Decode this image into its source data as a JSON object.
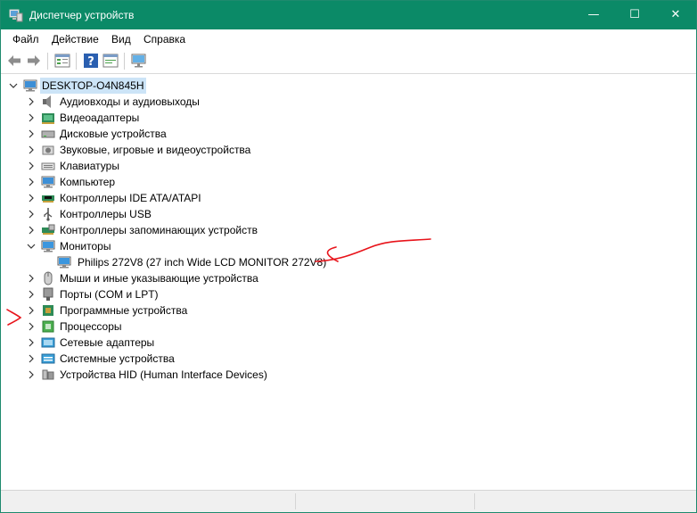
{
  "window": {
    "title": "Диспетчер устройств",
    "controls": {
      "minimize": "—",
      "maximize": "☐",
      "close": "✕"
    },
    "accent_color": "#0b8a67"
  },
  "menu": [
    "Файл",
    "Действие",
    "Вид",
    "Справка"
  ],
  "toolbar": {
    "buttons": [
      "back-arrow-icon",
      "forward-arrow-icon",
      "properties-icon",
      "help-icon",
      "scan-icon",
      "monitor-icon"
    ]
  },
  "tree": {
    "root": {
      "label": "DESKTOP-O4N845H",
      "icon": "computer-icon",
      "expanded": true
    },
    "categories": [
      {
        "label": "Аудиовходы и аудиовыходы",
        "icon": "speaker-icon",
        "expanded": false
      },
      {
        "label": "Видеоадаптеры",
        "icon": "display-adapter-icon",
        "expanded": false
      },
      {
        "label": "Дисковые устройства",
        "icon": "disk-drive-icon",
        "expanded": false
      },
      {
        "label": "Звуковые, игровые и видеоустройства",
        "icon": "sound-icon",
        "expanded": false
      },
      {
        "label": "Клавиатуры",
        "icon": "keyboard-icon",
        "expanded": false
      },
      {
        "label": "Компьютер",
        "icon": "computer-icon",
        "expanded": false
      },
      {
        "label": "Контроллеры IDE ATA/ATAPI",
        "icon": "ide-controller-icon",
        "expanded": false
      },
      {
        "label": "Контроллеры USB",
        "icon": "usb-icon",
        "expanded": false
      },
      {
        "label": "Контроллеры запоминающих устройств",
        "icon": "storage-controller-icon",
        "expanded": false
      },
      {
        "label": "Мониторы",
        "icon": "monitor-icon",
        "expanded": true,
        "children": [
          {
            "label": "Philips 272V8 (27 inch Wide LCD MONITOR 272V8)",
            "icon": "monitor-icon"
          }
        ]
      },
      {
        "label": "Мыши и иные указывающие устройства",
        "icon": "mouse-icon",
        "expanded": false
      },
      {
        "label": "Порты (COM и LPT)",
        "icon": "port-icon",
        "expanded": false
      },
      {
        "label": "Программные устройства",
        "icon": "software-device-icon",
        "expanded": false
      },
      {
        "label": "Процессоры",
        "icon": "processor-icon",
        "expanded": false
      },
      {
        "label": "Сетевые адаптеры",
        "icon": "network-adapter-icon",
        "expanded": false
      },
      {
        "label": "Системные устройства",
        "icon": "system-device-icon",
        "expanded": false
      },
      {
        "label": "Устройства HID (Human Interface Devices)",
        "icon": "hid-icon",
        "expanded": false
      }
    ]
  },
  "annotations": {
    "color": "#e8141b",
    "marks": [
      "arrow-mark-left",
      "arrow-mark-right"
    ]
  }
}
